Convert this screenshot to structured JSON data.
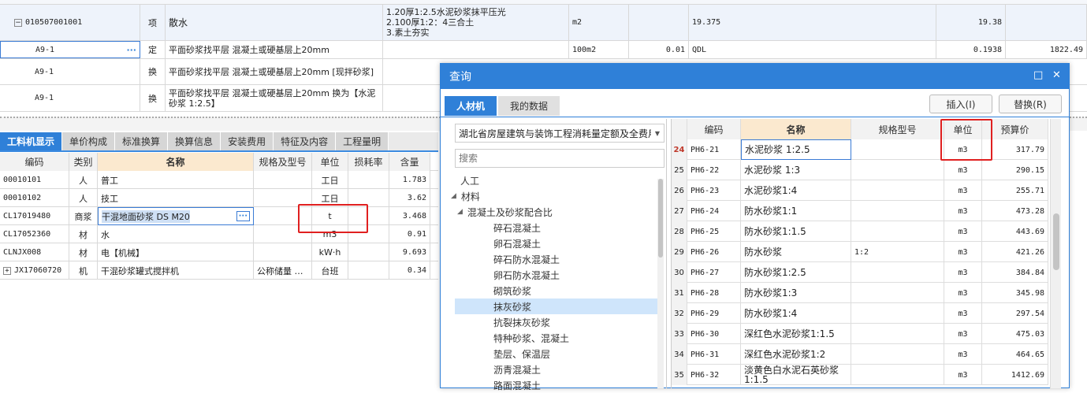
{
  "top_rows": [
    {
      "code": "010507001001",
      "type": "项",
      "name": "散水",
      "desc_lines": [
        "1.20厚1:2.5水泥砂浆抹平压光",
        "2.100厚1:2：4三合土",
        "3.素土夯实"
      ],
      "unit": "m2",
      "qty": "",
      "expr": "19.375",
      "amount": "19.38",
      "price": ""
    },
    {
      "code": "A9-1",
      "type": "定",
      "name": "平面砂浆找平层 混凝土或硬基层上20mm",
      "desc_lines": [],
      "unit": "100m2",
      "qty": "0.01",
      "expr": "QDL",
      "amount": "0.1938",
      "price": "1822.49"
    },
    {
      "code": "A9-1",
      "type": "换",
      "name": "平面砂浆找平层 混凝土或硬基层上20mm  [现拌砂浆]",
      "desc_lines": [],
      "unit": "",
      "qty": "",
      "expr": "",
      "amount": "",
      "price": ""
    },
    {
      "code": "A9-1",
      "type": "换",
      "name": "平面砂浆找平层 混凝土或硬基层上20mm  换为【水泥砂浆 1:2.5】",
      "desc_lines": [],
      "unit": "",
      "qty": "",
      "expr": "",
      "amount": "",
      "price": ""
    }
  ],
  "tabs": [
    "工料机显示",
    "单价构成",
    "标准换算",
    "换算信息",
    "安装费用",
    "特征及内容",
    "工程量明"
  ],
  "mat_headers": {
    "code": "编码",
    "cat": "类别",
    "name": "名称",
    "spec": "规格及型号",
    "unit": "单位",
    "loss": "损耗率",
    "qty": "含量"
  },
  "mat_rows": [
    {
      "code": "00010101",
      "cat": "人",
      "name": "普工",
      "spec": "",
      "unit": "工日",
      "loss": "",
      "qty": "1.783"
    },
    {
      "code": "00010102",
      "cat": "人",
      "name": "技工",
      "spec": "",
      "unit": "工日",
      "loss": "",
      "qty": "3.62"
    },
    {
      "code": "CL17019480",
      "cat": "商浆",
      "name": "干混地面砂浆 DS M20",
      "spec": "",
      "unit": "t",
      "loss": "",
      "qty": "3.468"
    },
    {
      "code": "CL17052360",
      "cat": "材",
      "name": "水",
      "spec": "",
      "unit": "m3",
      "loss": "",
      "qty": "0.91"
    },
    {
      "code": "CLNJX008",
      "cat": "材",
      "name": "电【机械】",
      "spec": "",
      "unit": "kW·h",
      "loss": "",
      "qty": "9.693"
    },
    {
      "code": "JX17060720",
      "cat": "机",
      "name": "干混砂浆罐式搅拌机",
      "spec": "公称储量 …",
      "unit": "台班",
      "loss": "",
      "qty": "0.34"
    }
  ],
  "dialog": {
    "title": "查询",
    "tabs": [
      "人材机",
      "我的数据"
    ],
    "insert_label": "插入(I)",
    "replace_label": "替换(R)",
    "combo_value": "湖北省房屋建筑与装饰工程消耗量定额及全费用",
    "search_placeholder": "搜索",
    "tree": [
      {
        "label": "人工",
        "level": 1,
        "toggle": "",
        "selected": false
      },
      {
        "label": "材料",
        "level": 1,
        "toggle": "◢",
        "selected": false
      },
      {
        "label": "混凝土及砂浆配合比",
        "level": 2,
        "toggle": "◢",
        "selected": false
      },
      {
        "label": "碎石混凝土",
        "level": 3,
        "toggle": "",
        "selected": false
      },
      {
        "label": "卵石混凝土",
        "level": 3,
        "toggle": "",
        "selected": false
      },
      {
        "label": "碎石防水混凝土",
        "level": 3,
        "toggle": "",
        "selected": false
      },
      {
        "label": "卵石防水混凝土",
        "level": 3,
        "toggle": "",
        "selected": false
      },
      {
        "label": "砌筑砂浆",
        "level": 3,
        "toggle": "",
        "selected": false
      },
      {
        "label": "抹灰砂浆",
        "level": 3,
        "toggle": "",
        "selected": true
      },
      {
        "label": "抗裂抹灰砂浆",
        "level": 3,
        "toggle": "",
        "selected": false
      },
      {
        "label": "特种砂浆、混凝土",
        "level": 3,
        "toggle": "",
        "selected": false
      },
      {
        "label": "垫层、保温层",
        "level": 3,
        "toggle": "",
        "selected": false
      },
      {
        "label": "沥青混凝土",
        "level": 3,
        "toggle": "",
        "selected": false
      },
      {
        "label": "路面混凝土",
        "level": 3,
        "toggle": "",
        "selected": false
      }
    ],
    "grid_headers": {
      "code": "编码",
      "name": "名称",
      "spec": "规格型号",
      "unit": "单位",
      "price": "预算价"
    },
    "grid_rows": [
      {
        "no": "24",
        "code": "PH6-21",
        "name": "水泥砂浆 1:2.5",
        "spec": "",
        "unit": "m3",
        "price": "317.79"
      },
      {
        "no": "25",
        "code": "PH6-22",
        "name": "水泥砂浆 1:3",
        "spec": "",
        "unit": "m3",
        "price": "290.15"
      },
      {
        "no": "26",
        "code": "PH6-23",
        "name": "水泥砂浆1:4",
        "spec": "",
        "unit": "m3",
        "price": "255.71"
      },
      {
        "no": "27",
        "code": "PH6-24",
        "name": "防水砂浆1:1",
        "spec": "",
        "unit": "m3",
        "price": "473.28"
      },
      {
        "no": "28",
        "code": "PH6-25",
        "name": "防水砂浆1:1.5",
        "spec": "",
        "unit": "m3",
        "price": "443.69"
      },
      {
        "no": "29",
        "code": "PH6-26",
        "name": "防水砂浆",
        "spec": "1:2",
        "unit": "m3",
        "price": "421.26"
      },
      {
        "no": "30",
        "code": "PH6-27",
        "name": "防水砂浆1:2.5",
        "spec": "",
        "unit": "m3",
        "price": "384.84"
      },
      {
        "no": "31",
        "code": "PH6-28",
        "name": "防水砂浆1:3",
        "spec": "",
        "unit": "m3",
        "price": "345.98"
      },
      {
        "no": "32",
        "code": "PH6-29",
        "name": "防水砂浆1:4",
        "spec": "",
        "unit": "m3",
        "price": "297.54"
      },
      {
        "no": "33",
        "code": "PH6-30",
        "name": "深红色水泥砂浆1:1.5",
        "spec": "",
        "unit": "m3",
        "price": "475.03"
      },
      {
        "no": "34",
        "code": "PH6-31",
        "name": "深红色水泥砂浆1:2",
        "spec": "",
        "unit": "m3",
        "price": "464.65"
      },
      {
        "no": "35",
        "code": "PH6-32",
        "name": "淡黄色白水泥石英砂浆1:1.5",
        "spec": "",
        "unit": "m3",
        "price": "1412.69"
      }
    ]
  }
}
